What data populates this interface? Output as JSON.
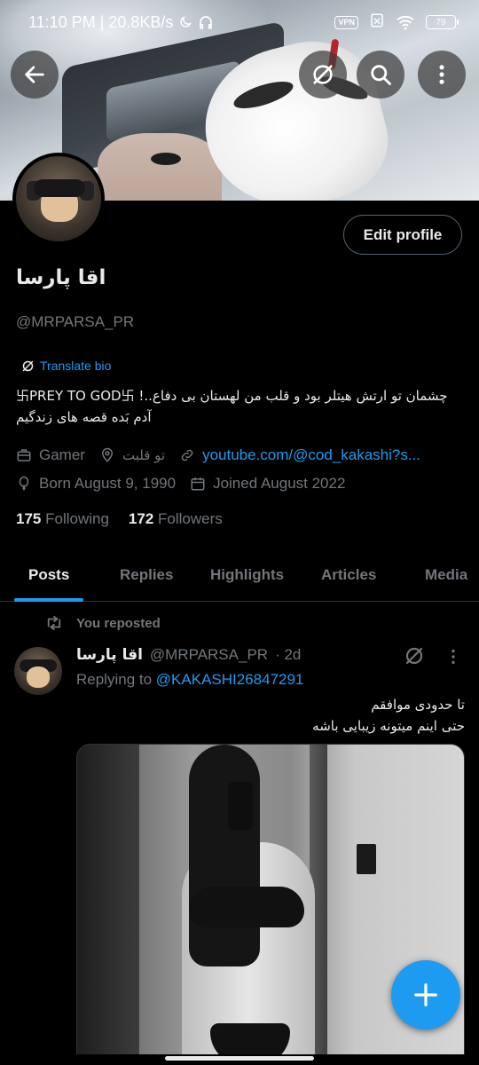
{
  "status": {
    "time_speed": "11:10 PM | 20.8KB/s",
    "vpn": "VPN",
    "battery": "79"
  },
  "profile": {
    "name": "اقا پارسا",
    "handle": "@MRPARSA_PR",
    "translate_label": "Translate bio",
    "bio_line1": "چشمان تو ارتش هیتلر بود و قلب من لهستان بی دفاع..! 卐PREY TO GOD卐",
    "bio_line2": "آدم بَده قصه های زندگیم",
    "category": "Gamer",
    "location": "تو قلبت",
    "website": "youtube.com/@cod_kakashi?s...",
    "born": "Born August 9, 1990",
    "joined": "Joined August 2022",
    "following_count": "175",
    "following_label": "Following",
    "followers_count": "172",
    "followers_label": "Followers",
    "edit_label": "Edit profile"
  },
  "tabs": [
    "Posts",
    "Replies",
    "Highlights",
    "Articles",
    "Media"
  ],
  "post": {
    "reposted_label": "You reposted",
    "author_name": "اقا پارسا",
    "author_handle": "@MRPARSA_PR",
    "time": "· 2d",
    "replying_prefix": "Replying to",
    "replying_to": "@KAKASHI26847291",
    "text_line1": "تا حدودی موافقم",
    "text_line2": "حتی اینم میتونه زیبایی باشه"
  },
  "icons": {
    "back": "back-arrow-icon",
    "translate": "translate-icon",
    "search": "search-icon",
    "more": "more-vertical-icon",
    "fab": "plus-icon"
  },
  "colors": {
    "accent": "#1d9bf0",
    "muted": "#71767b",
    "text": "#e7e9ea",
    "background": "#000000"
  }
}
